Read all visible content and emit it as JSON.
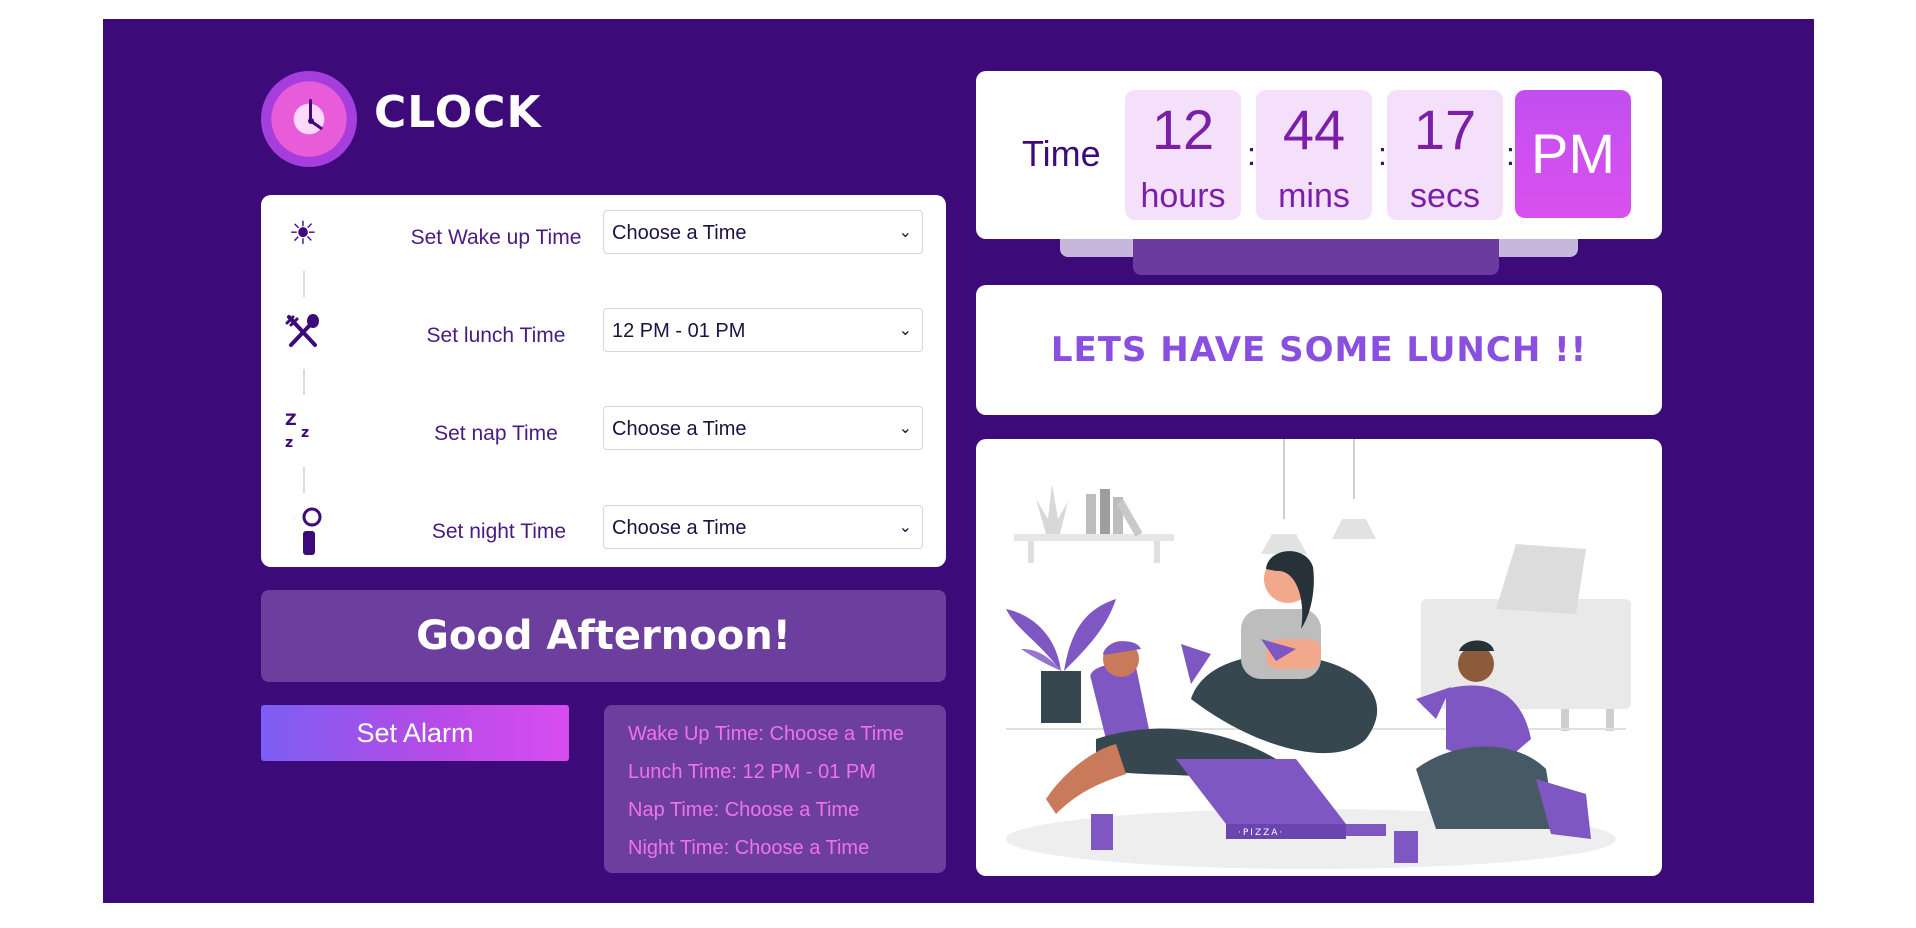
{
  "app": {
    "brand": "CLOCK"
  },
  "schedule": {
    "rows": [
      {
        "icon": "sun-icon",
        "label": "Set Wake up Time",
        "selected": "Choose a Time"
      },
      {
        "icon": "fork-spoon-icon",
        "label": "Set lunch Time",
        "selected": "12 PM - 01 PM"
      },
      {
        "icon": "zzz-icon",
        "label": "Set nap Time",
        "selected": "Choose a Time"
      },
      {
        "icon": "moon-night-icon",
        "label": "Set night Time",
        "selected": "Choose a Time"
      }
    ]
  },
  "greeting": "Good Afternoon!",
  "alarm_button": "Set Alarm",
  "summary": {
    "wake": "Wake Up Time: Choose a Time",
    "lunch": "Lunch Time: 12 PM - 01 PM",
    "nap": "Nap Time: Choose a Time",
    "night": "Night Time: Choose a Time"
  },
  "clock": {
    "label": "Time",
    "hours": "12",
    "hours_unit": "hours",
    "mins": "44",
    "mins_unit": "mins",
    "secs": "17",
    "secs_unit": "secs",
    "ampm": "PM",
    "sep": ":"
  },
  "message": "LETS HAVE SOME LUNCH !!",
  "illustration": {
    "pizza_box_text": "·PIZZA·"
  },
  "colors": {
    "background": "#3d0a7a",
    "panel": "#6c3f9e",
    "accent": "#d950ee",
    "summary_text": "#f072e8"
  }
}
